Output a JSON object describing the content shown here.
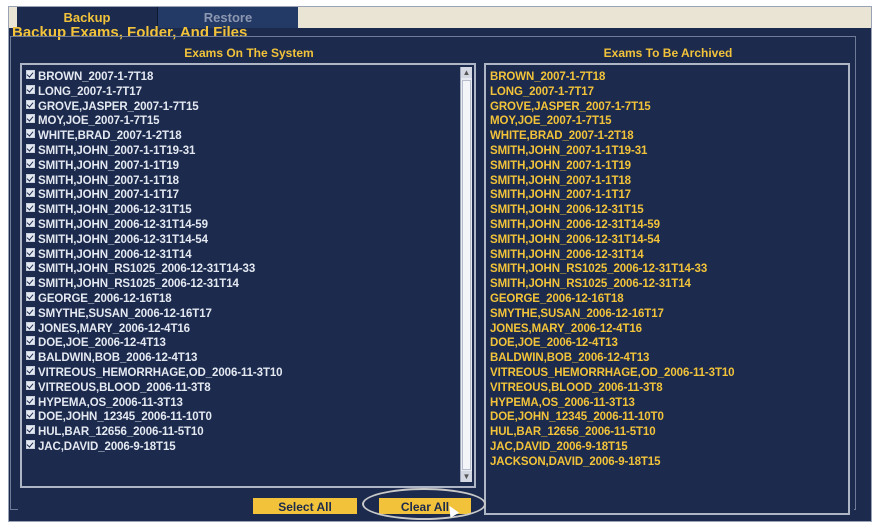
{
  "tabs": [
    {
      "label": "Backup",
      "active": true
    },
    {
      "label": "Restore",
      "active": false
    }
  ],
  "section": {
    "title": "Backup Exams, Folder, And Files"
  },
  "left_panel": {
    "header": "Exams On The System",
    "items": [
      "BROWN_2007-1-7T18",
      "LONG_2007-1-7T17",
      "GROVE,JASPER_2007-1-7T15",
      "MOY,JOE_2007-1-7T15",
      "WHITE,BRAD_2007-1-2T18",
      "SMITH,JOHN_2007-1-1T19-31",
      "SMITH,JOHN_2007-1-1T19",
      "SMITH,JOHN_2007-1-1T18",
      "SMITH,JOHN_2007-1-1T17",
      "SMITH,JOHN_2006-12-31T15",
      "SMITH,JOHN_2006-12-31T14-59",
      "SMITH,JOHN_2006-12-31T14-54",
      "SMITH,JOHN_2006-12-31T14",
      "SMITH,JOHN_RS1025_2006-12-31T14-33",
      "SMITH,JOHN_RS1025_2006-12-31T14",
      "GEORGE_2006-12-16T18",
      "SMYTHE,SUSAN_2006-12-16T17",
      "JONES,MARY_2006-12-4T16",
      "DOE,JOE_2006-12-4T13",
      "BALDWIN,BOB_2006-12-4T13",
      "VITREOUS_HEMORRHAGE,OD_2006-11-3T10",
      "VITREOUS,BLOOD_2006-11-3T8",
      "HYPEMA,OS_2006-11-3T13",
      "DOE,JOHN_12345_2006-11-10T0",
      "HUL,BAR_12656_2006-11-5T10",
      "JAC,DAVID_2006-9-18T15"
    ]
  },
  "right_panel": {
    "header": "Exams To Be Archived",
    "items": [
      "BROWN_2007-1-7T18",
      "LONG_2007-1-7T17",
      "GROVE,JASPER_2007-1-7T15",
      "MOY,JOE_2007-1-7T15",
      "WHITE,BRAD_2007-1-2T18",
      "SMITH,JOHN_2007-1-1T19-31",
      "SMITH,JOHN_2007-1-1T19",
      "SMITH,JOHN_2007-1-1T18",
      "SMITH,JOHN_2007-1-1T17",
      "SMITH,JOHN_2006-12-31T15",
      "SMITH,JOHN_2006-12-31T14-59",
      "SMITH,JOHN_2006-12-31T14-54",
      "SMITH,JOHN_2006-12-31T14",
      "SMITH,JOHN_RS1025_2006-12-31T14-33",
      "SMITH,JOHN_RS1025_2006-12-31T14",
      "GEORGE_2006-12-16T18",
      "SMYTHE,SUSAN_2006-12-16T17",
      "JONES,MARY_2006-12-4T16",
      "DOE,JOE_2006-12-4T13",
      "BALDWIN,BOB_2006-12-4T13",
      "VITREOUS_HEMORRHAGE,OD_2006-11-3T10",
      "VITREOUS,BLOOD_2006-11-3T8",
      "HYPEMA,OS_2006-11-3T13",
      "DOE,JOHN_12345_2006-11-10T0",
      "HUL,BAR_12656_2006-11-5T10",
      "JAC,DAVID_2006-9-18T15",
      "JACKSON,DAVID_2006-9-18T15"
    ]
  },
  "buttons": {
    "select_all": "Select All",
    "clear_all": "Clear All"
  },
  "colors": {
    "background": "#1b2a4d",
    "accent": "#f2c33a",
    "text": "#e4e8f1"
  }
}
